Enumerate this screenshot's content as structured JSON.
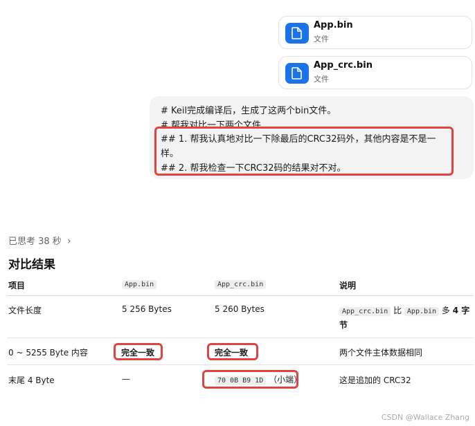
{
  "attachments": [
    {
      "name": "App.bin",
      "type": "文件"
    },
    {
      "name": "App_crc.bin",
      "type": "文件"
    }
  ],
  "message": {
    "lines": [
      "# Keil完成编译后，生成了这两个bin文件。",
      "# 帮我对比一下两个文件",
      "## 1. 帮我认真地对比一下除最后的CRC32码外，其他内容是不是一",
      "样。",
      "## 2. 帮我检查一下CRC32码的结果对不对。"
    ]
  },
  "thought": {
    "label": "已思考 38 秒",
    "chevron": "›"
  },
  "section_title": "对比结果",
  "table": {
    "headers": {
      "item": "项目",
      "app_bin": "App.bin",
      "app_crc_bin": "App_crc.bin",
      "note": "说明"
    },
    "rows": [
      {
        "item": "文件长度",
        "app_bin": "5 256 Bytes",
        "app_crc_bin": "5 260 Bytes",
        "note": {
          "code1": "App_crc.bin",
          "mid": "比",
          "code2": "App.bin",
          "pre": "多",
          "bold": "4 字",
          "tail": "节"
        }
      },
      {
        "item": "0 ~ 5255 Byte 内容",
        "app_bin": "完全一致",
        "app_crc_bin": "完全一致",
        "note": "两个文件主体数据相同"
      },
      {
        "item": "末尾 4 Byte",
        "app_bin": "—",
        "app_crc_code": "70 0B B9 1D",
        "app_crc_suffix": "（小端）",
        "note": "这是追加的 CRC32"
      }
    ]
  },
  "watermark": "CSDN @Wallace Zhang",
  "colors": {
    "accent": "#1a73e8",
    "highlight": "#e0443e"
  }
}
